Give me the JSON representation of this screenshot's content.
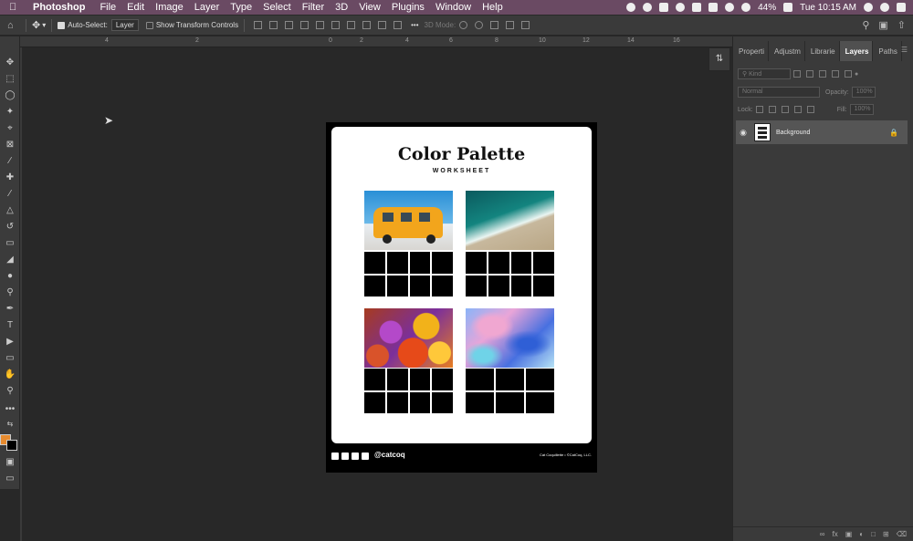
{
  "menubar": {
    "app_name": "Photoshop",
    "items": [
      "File",
      "Edit",
      "Image",
      "Layer",
      "Type",
      "Select",
      "Filter",
      "3D",
      "View",
      "Plugins",
      "Window",
      "Help"
    ],
    "battery": "44%",
    "clock": "Tue 10:15 AM"
  },
  "options": {
    "auto_select_label": "Auto-Select:",
    "auto_select_value": "Layer",
    "show_transform_label": "Show Transform Controls",
    "mode_label": "3D Mode:"
  },
  "ruler": {
    "ticks": [
      "4",
      "2",
      "0",
      "2",
      "4",
      "6",
      "8",
      "10",
      "12",
      "14",
      "16"
    ]
  },
  "document": {
    "title": "Color Palette",
    "subtitle": "WORKSHEET",
    "footer_handle": "@catcoq",
    "footer_credit": "Cat Coquillette • ©CatCoq, LLC."
  },
  "panels": {
    "tabs": [
      "Properti",
      "Adjustm",
      "Librarie",
      "Layers",
      "Paths"
    ],
    "active_tab": "Layers",
    "filter_kind": "Kind",
    "blend_mode": "Normal",
    "opacity_label": "Opacity:",
    "opacity_value": "100%",
    "lock_label": "Lock:",
    "fill_label": "Fill:",
    "fill_value": "100%",
    "layers": [
      {
        "name": "Background",
        "visible": true,
        "locked": true
      }
    ]
  }
}
